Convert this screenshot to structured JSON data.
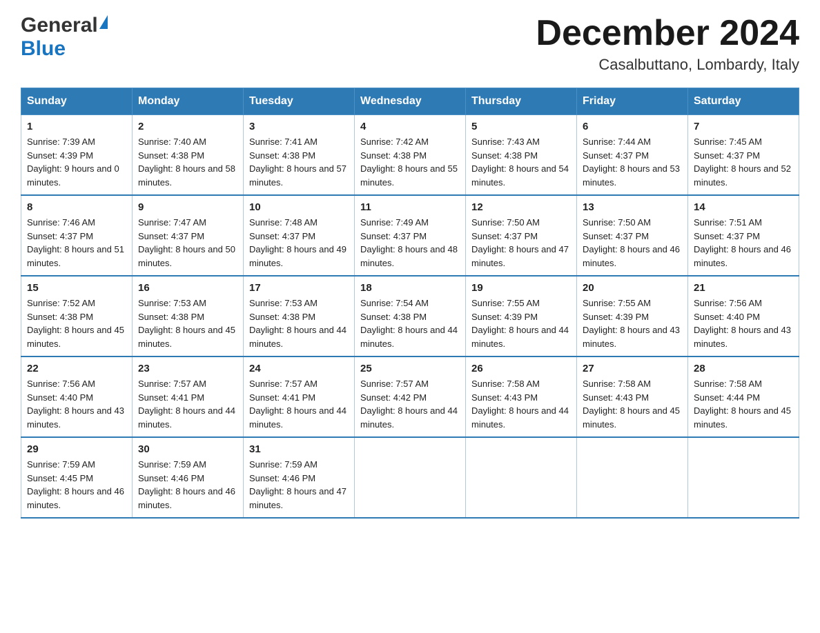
{
  "logo": {
    "general": "General",
    "blue": "Blue"
  },
  "header": {
    "title": "December 2024",
    "subtitle": "Casalbuttano, Lombardy, Italy"
  },
  "days_of_week": [
    "Sunday",
    "Monday",
    "Tuesday",
    "Wednesday",
    "Thursday",
    "Friday",
    "Saturday"
  ],
  "weeks": [
    [
      {
        "day": "1",
        "sunrise": "7:39 AM",
        "sunset": "4:39 PM",
        "daylight": "9 hours and 0 minutes."
      },
      {
        "day": "2",
        "sunrise": "7:40 AM",
        "sunset": "4:38 PM",
        "daylight": "8 hours and 58 minutes."
      },
      {
        "day": "3",
        "sunrise": "7:41 AM",
        "sunset": "4:38 PM",
        "daylight": "8 hours and 57 minutes."
      },
      {
        "day": "4",
        "sunrise": "7:42 AM",
        "sunset": "4:38 PM",
        "daylight": "8 hours and 55 minutes."
      },
      {
        "day": "5",
        "sunrise": "7:43 AM",
        "sunset": "4:38 PM",
        "daylight": "8 hours and 54 minutes."
      },
      {
        "day": "6",
        "sunrise": "7:44 AM",
        "sunset": "4:37 PM",
        "daylight": "8 hours and 53 minutes."
      },
      {
        "day": "7",
        "sunrise": "7:45 AM",
        "sunset": "4:37 PM",
        "daylight": "8 hours and 52 minutes."
      }
    ],
    [
      {
        "day": "8",
        "sunrise": "7:46 AM",
        "sunset": "4:37 PM",
        "daylight": "8 hours and 51 minutes."
      },
      {
        "day": "9",
        "sunrise": "7:47 AM",
        "sunset": "4:37 PM",
        "daylight": "8 hours and 50 minutes."
      },
      {
        "day": "10",
        "sunrise": "7:48 AM",
        "sunset": "4:37 PM",
        "daylight": "8 hours and 49 minutes."
      },
      {
        "day": "11",
        "sunrise": "7:49 AM",
        "sunset": "4:37 PM",
        "daylight": "8 hours and 48 minutes."
      },
      {
        "day": "12",
        "sunrise": "7:50 AM",
        "sunset": "4:37 PM",
        "daylight": "8 hours and 47 minutes."
      },
      {
        "day": "13",
        "sunrise": "7:50 AM",
        "sunset": "4:37 PM",
        "daylight": "8 hours and 46 minutes."
      },
      {
        "day": "14",
        "sunrise": "7:51 AM",
        "sunset": "4:37 PM",
        "daylight": "8 hours and 46 minutes."
      }
    ],
    [
      {
        "day": "15",
        "sunrise": "7:52 AM",
        "sunset": "4:38 PM",
        "daylight": "8 hours and 45 minutes."
      },
      {
        "day": "16",
        "sunrise": "7:53 AM",
        "sunset": "4:38 PM",
        "daylight": "8 hours and 45 minutes."
      },
      {
        "day": "17",
        "sunrise": "7:53 AM",
        "sunset": "4:38 PM",
        "daylight": "8 hours and 44 minutes."
      },
      {
        "day": "18",
        "sunrise": "7:54 AM",
        "sunset": "4:38 PM",
        "daylight": "8 hours and 44 minutes."
      },
      {
        "day": "19",
        "sunrise": "7:55 AM",
        "sunset": "4:39 PM",
        "daylight": "8 hours and 44 minutes."
      },
      {
        "day": "20",
        "sunrise": "7:55 AM",
        "sunset": "4:39 PM",
        "daylight": "8 hours and 43 minutes."
      },
      {
        "day": "21",
        "sunrise": "7:56 AM",
        "sunset": "4:40 PM",
        "daylight": "8 hours and 43 minutes."
      }
    ],
    [
      {
        "day": "22",
        "sunrise": "7:56 AM",
        "sunset": "4:40 PM",
        "daylight": "8 hours and 43 minutes."
      },
      {
        "day": "23",
        "sunrise": "7:57 AM",
        "sunset": "4:41 PM",
        "daylight": "8 hours and 44 minutes."
      },
      {
        "day": "24",
        "sunrise": "7:57 AM",
        "sunset": "4:41 PM",
        "daylight": "8 hours and 44 minutes."
      },
      {
        "day": "25",
        "sunrise": "7:57 AM",
        "sunset": "4:42 PM",
        "daylight": "8 hours and 44 minutes."
      },
      {
        "day": "26",
        "sunrise": "7:58 AM",
        "sunset": "4:43 PM",
        "daylight": "8 hours and 44 minutes."
      },
      {
        "day": "27",
        "sunrise": "7:58 AM",
        "sunset": "4:43 PM",
        "daylight": "8 hours and 45 minutes."
      },
      {
        "day": "28",
        "sunrise": "7:58 AM",
        "sunset": "4:44 PM",
        "daylight": "8 hours and 45 minutes."
      }
    ],
    [
      {
        "day": "29",
        "sunrise": "7:59 AM",
        "sunset": "4:45 PM",
        "daylight": "8 hours and 46 minutes."
      },
      {
        "day": "30",
        "sunrise": "7:59 AM",
        "sunset": "4:46 PM",
        "daylight": "8 hours and 46 minutes."
      },
      {
        "day": "31",
        "sunrise": "7:59 AM",
        "sunset": "4:46 PM",
        "daylight": "8 hours and 47 minutes."
      },
      null,
      null,
      null,
      null
    ]
  ]
}
